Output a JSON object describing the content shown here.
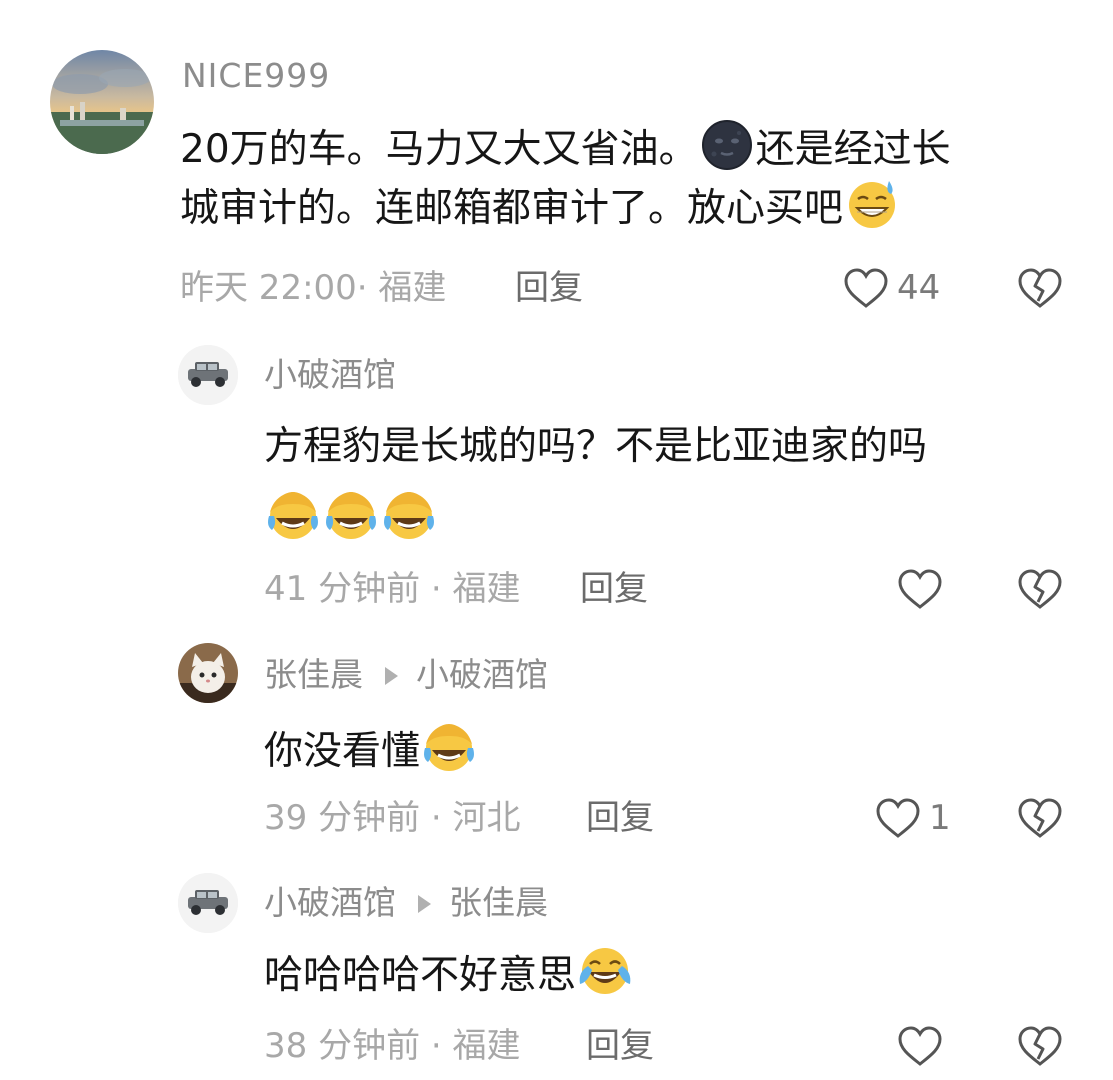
{
  "comments": [
    {
      "user": "NICE999",
      "line1": "20万的车。马力又大又省油。",
      "line1_after_emoji": "还是经过长",
      "line2": "城审计的。连邮箱都审计了。放心买吧",
      "emoji_1": "new-moon-face",
      "emoji_2": "grinning-sweat-face",
      "meta": "昨天 22:00· 福建",
      "reply": "回复",
      "likes": "44"
    },
    {
      "user": "小破酒馆",
      "line1": "方程豹是长城的吗？不是比亚迪家的吗",
      "emoji": "face-with-tears-covering-eyes",
      "emoji_count": 3,
      "meta": "41 分钟前 · 福建",
      "reply": "回复"
    },
    {
      "user": "张佳晨",
      "reply_to": "小破酒馆",
      "text": "你没看懂",
      "emoji": "face-with-tears-covering-eyes",
      "meta": "39 分钟前 · 河北",
      "reply": "回复",
      "likes": "1"
    },
    {
      "user": "小破酒馆",
      "reply_to": "张佳晨",
      "text": "哈哈哈哈不好意思",
      "emoji": "face-with-tears-of-joy",
      "meta": "38 分钟前 · 福建",
      "reply": "回复"
    }
  ],
  "colors": {
    "name": "#8c8c8c",
    "meta": "#a8a8a8",
    "text": "#161616",
    "icon": "#555555"
  }
}
